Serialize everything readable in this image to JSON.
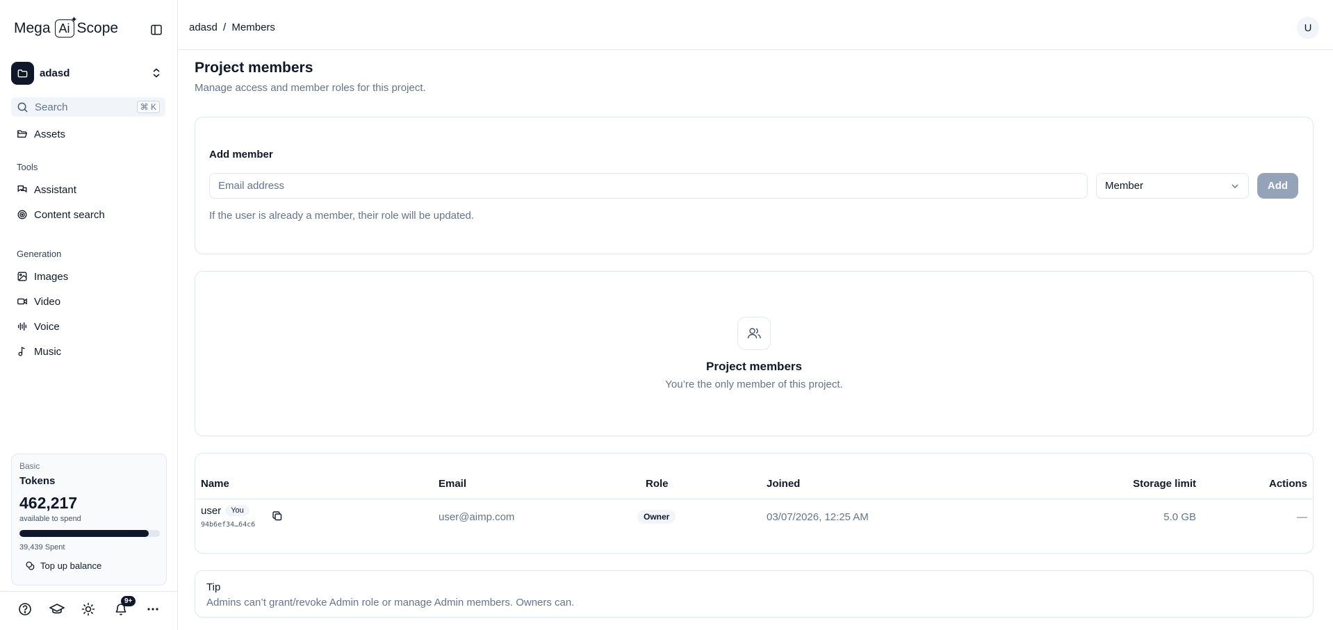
{
  "brand": {
    "name_part1": "Mega",
    "name_ai": "Ai",
    "name_part2": "Scope"
  },
  "project": {
    "name": "adasd"
  },
  "search": {
    "label": "Search",
    "shortcut": "⌘ K"
  },
  "sidebar": {
    "assets_label": "Assets",
    "tools_section": "Tools",
    "tools": [
      {
        "label": "Assistant",
        "icon": "chat-icon"
      },
      {
        "label": "Content search",
        "icon": "content-search-icon"
      }
    ],
    "generation_section": "Generation",
    "generation": [
      {
        "label": "Images",
        "icon": "image-icon"
      },
      {
        "label": "Video",
        "icon": "video-icon"
      },
      {
        "label": "Voice",
        "icon": "waveform-icon"
      },
      {
        "label": "Music",
        "icon": "music-note-icon"
      }
    ]
  },
  "tokens": {
    "plan": "Basic",
    "title": "Tokens",
    "amount": "462,217",
    "available_label": "available to spend",
    "spent": "39,439 Spent",
    "progress_fraction": 0.92,
    "topup_label": "Top up balance"
  },
  "bottom_bar": {
    "notification_badge": "9+"
  },
  "header": {
    "breadcrumb_project": "adasd",
    "breadcrumb_sep": "/",
    "breadcrumb_page": "Members",
    "avatar_initial": "U"
  },
  "page": {
    "title": "Project members",
    "subtitle": "Manage access and member roles for this project."
  },
  "add_member": {
    "label": "Add member",
    "email_placeholder": "Email address",
    "role_value": "Member",
    "add_button": "Add",
    "hint": "If the user is already a member, their role will be updated."
  },
  "empty_state": {
    "title": "Project members",
    "text": "You’re the only member of this project."
  },
  "table": {
    "columns": {
      "name": "Name",
      "email": "Email",
      "role": "Role",
      "joined": "Joined",
      "storage": "Storage limit",
      "actions": "Actions"
    },
    "rows": [
      {
        "name": "user",
        "you_badge": "You",
        "id": "94b6ef34…64c6",
        "email": "user@aimp.com",
        "role": "Owner",
        "joined": "03/07/2026, 12:25 AM",
        "storage": "5.0 GB",
        "actions": "—"
      }
    ]
  },
  "tip": {
    "title": "Tip",
    "text": "Admins can’t grant/revoke Admin role or manage Admin members. Owners can."
  },
  "colors": {
    "primary": "#0f172a",
    "muted": "#64748b",
    "border": "#e2e8f0",
    "disabled_button": "#94a3b8"
  }
}
